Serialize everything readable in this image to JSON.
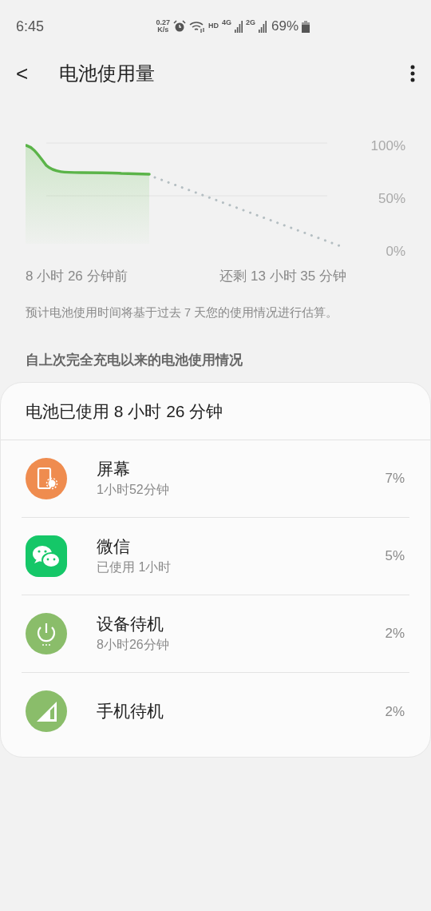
{
  "status_bar": {
    "time": "6:45",
    "net_speed": "0.27",
    "net_unit": "K/s",
    "hd": "HD",
    "sim1": "4G",
    "sim2": "2G",
    "battery": "69%"
  },
  "header": {
    "back": "<",
    "title": "电池使用量"
  },
  "graph": {
    "y_labels": [
      "100%",
      "50%",
      "0%"
    ],
    "start_label": "8 小时 26 分钟前",
    "end_label": "还剩 13 小时 35 分钟"
  },
  "note": "预计电池使用时间将基于过去 7 天您的使用情况进行估算。",
  "section_title": "自上次完全充电以来的电池使用情况",
  "card": {
    "title": "电池已使用 8 小时 26 分钟",
    "items": [
      {
        "kind": "screen",
        "name": "屏幕",
        "detail": "1小时52分钟",
        "percent": "7%"
      },
      {
        "kind": "app",
        "name": "微信",
        "detail": "已使用 1小时",
        "percent": "5%"
      },
      {
        "kind": "device_idle",
        "name": "设备待机",
        "detail": "8小时26分钟",
        "percent": "2%"
      },
      {
        "kind": "phone_idle",
        "name": "手机待机",
        "percent": "2%"
      }
    ]
  }
}
